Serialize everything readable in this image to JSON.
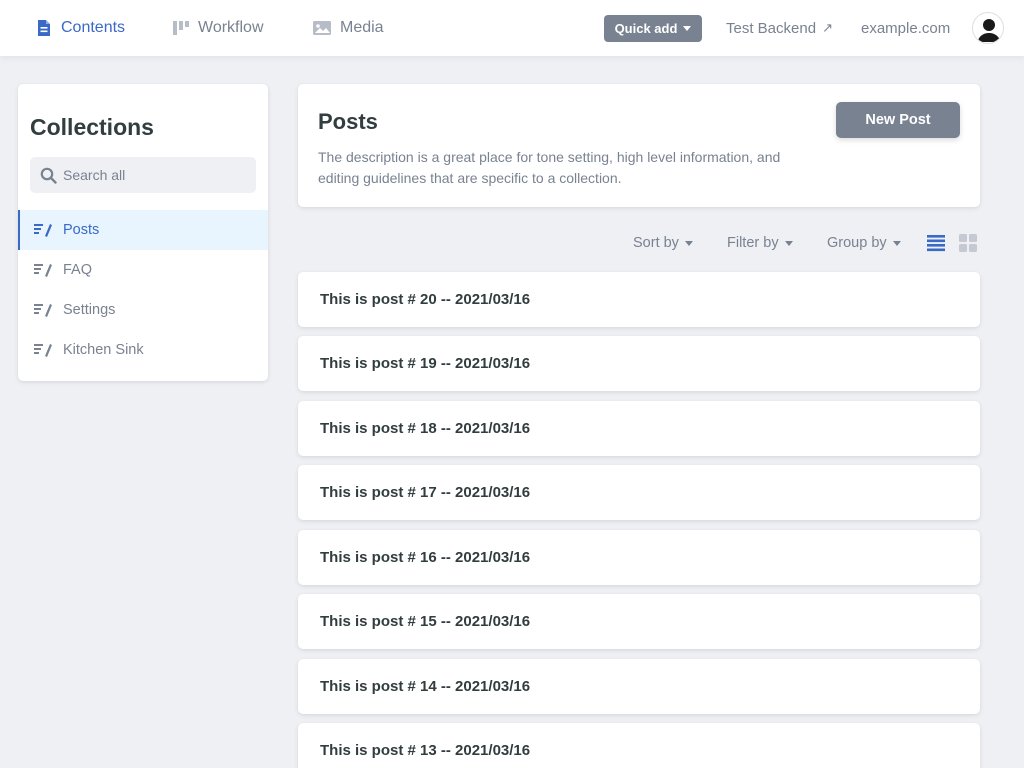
{
  "nav": {
    "contents": "Contents",
    "workflow": "Workflow",
    "media": "Media",
    "quick_add": "Quick add",
    "test_backend": "Test Backend",
    "test_backend_icon": "↗",
    "site": "example.com"
  },
  "sidebar": {
    "title": "Collections",
    "search_placeholder": "Search all",
    "items": [
      {
        "label": "Posts"
      },
      {
        "label": "FAQ"
      },
      {
        "label": "Settings"
      },
      {
        "label": "Kitchen Sink"
      }
    ]
  },
  "main": {
    "title": "Posts",
    "description": "The description is a great place for tone setting, high level information, and editing guidelines that are specific to a collection.",
    "new_button": "New Post",
    "sort_by": "Sort by",
    "filter_by": "Filter by",
    "group_by": "Group by"
  },
  "entries": [
    "This is post # 20 -- 2021/03/16",
    "This is post # 19 -- 2021/03/16",
    "This is post # 18 -- 2021/03/16",
    "This is post # 17 -- 2021/03/16",
    "This is post # 16 -- 2021/03/16",
    "This is post # 15 -- 2021/03/16",
    "This is post # 14 -- 2021/03/16",
    "This is post # 13 -- 2021/03/16"
  ],
  "colors": {
    "active": "#3a69c7",
    "muted": "#798291",
    "background": "#eff0f4",
    "active_bg": "#e8f5fe"
  },
  "icons": {
    "contents": "document-icon",
    "workflow": "workflow-icon",
    "media": "image-icon",
    "search": "search-icon",
    "collection": "write-icon",
    "list_view": "list-view-icon",
    "grid_view": "grid-view-icon",
    "avatar": "user-avatar-icon"
  }
}
